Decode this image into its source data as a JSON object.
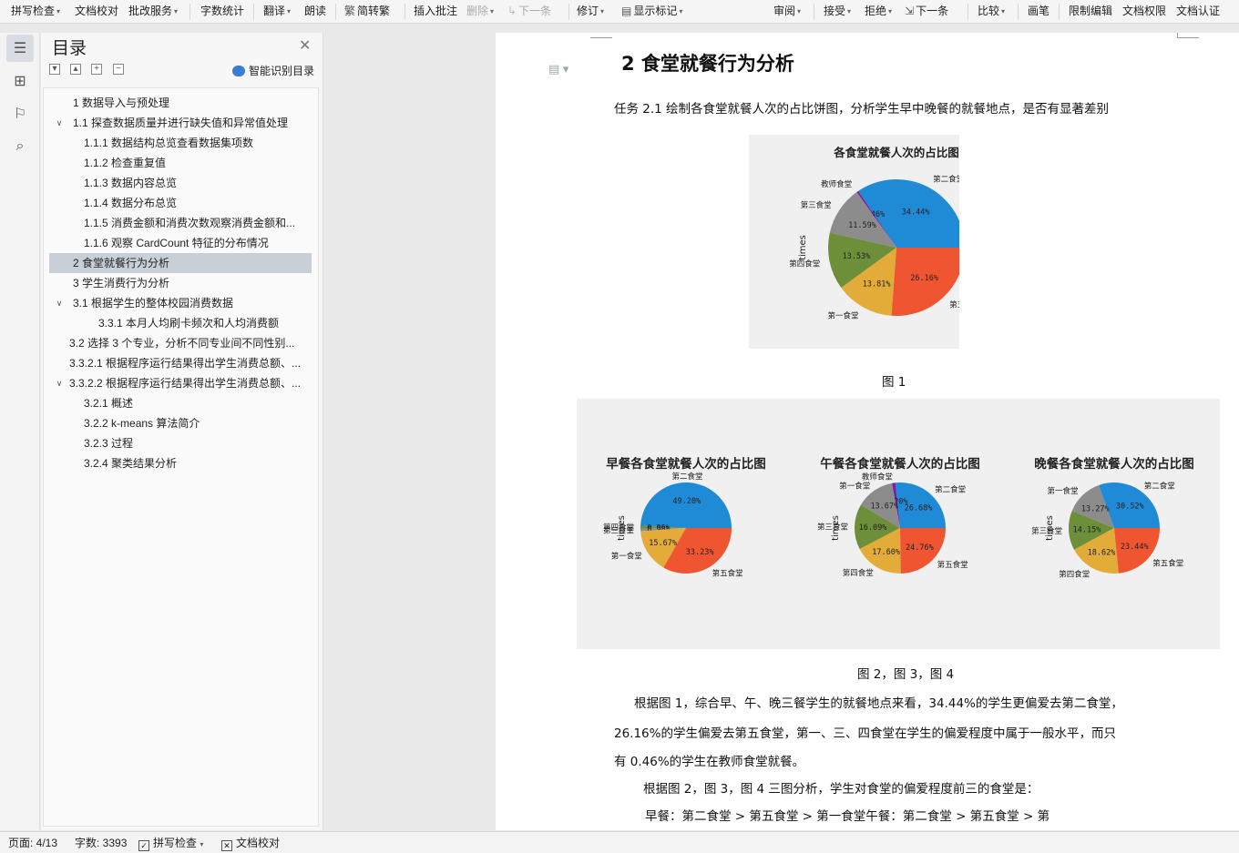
{
  "toolbar": {
    "items": [
      {
        "label": "拼写检查",
        "caret": true
      },
      {
        "label": "文档校对",
        "caret": false
      },
      {
        "label": "批改服务",
        "caret": true
      },
      {
        "label": "字数统计",
        "caret": false
      },
      {
        "label": "翻译",
        "caret": true
      },
      {
        "label": "朗读",
        "caret": false
      },
      {
        "label": "简转繁",
        "caret": false
      },
      {
        "label": "插入批注",
        "caret": false
      },
      {
        "label": "删除",
        "caret": true
      },
      {
        "label": "下一条",
        "caret": false
      },
      {
        "label": "修订",
        "caret": true
      },
      {
        "label": "显示标记",
        "caret": true
      },
      {
        "label": "审阅",
        "caret": true
      },
      {
        "label": "接受",
        "caret": true
      },
      {
        "label": "拒绝",
        "caret": true
      },
      {
        "label": "下一条",
        "caret": false
      },
      {
        "label": "比较",
        "caret": true
      },
      {
        "label": "画笔",
        "caret": false
      },
      {
        "label": "限制编辑",
        "caret": false
      },
      {
        "label": "文档权限",
        "caret": false
      },
      {
        "label": "文档认证",
        "caret": false
      }
    ]
  },
  "sidebar": {
    "title": "目录",
    "smart_toc_label": "智能识别目录",
    "toc": [
      {
        "text": "1 数据导入与预处理"
      },
      {
        "text": "1.1 探查数据质量并进行缺失值和异常值处理",
        "expanded": true
      },
      {
        "text": "1.1.1 数据结构总览查看数据集项数"
      },
      {
        "text": "1.1.2 检查重复值"
      },
      {
        "text": "1.1.3 数据内容总览"
      },
      {
        "text": "1.1.4 数据分布总览"
      },
      {
        "text": "1.1.5 消费金额和消费次数观察消费金额和..."
      },
      {
        "text": "1.1.6 观察 CardCount 特征的分布情况"
      },
      {
        "text": "2 食堂就餐行为分析",
        "selected": true
      },
      {
        "text": "3 学生消费行为分析"
      },
      {
        "text": "3.1 根据学生的整体校园消费数据",
        "expanded": true
      },
      {
        "text": "3.3.1 本月人均刷卡频次和人均消费额"
      },
      {
        "text": "3.2 选择 3 个专业，分析不同专业间不同性别..."
      },
      {
        "text": "3.3.2.1 根据程序运行结果得出学生消费总额、..."
      },
      {
        "text": "3.3.2.2 根据程序运行结果得出学生消费总额、...",
        "expanded": true
      },
      {
        "text": "3.2.1 概述"
      },
      {
        "text": "3.2.2 k-means 算法简介"
      },
      {
        "text": "3.2.3 过程"
      },
      {
        "text": "3.2.4 聚类结果分析"
      }
    ]
  },
  "document": {
    "heading": "2 食堂就餐行为分析",
    "task_text": "任务 2.1 绘制各食堂就餐人次的占比饼图，分析学生早中晚餐的就餐地点，是否有显著差别",
    "caption1": "图 1",
    "caption2": "图 2，图 3，图 4",
    "para1_line1": "根据图 1，综合早、午、晚三餐学生的就餐地点来看，34.44%的学生更偏爱去第二食堂，",
    "para1_line2": "26.16%的学生偏爱去第五食堂，第一、三、四食堂在学生的偏爱程度中属于一般水平，而只",
    "para1_line3": "有 0.46%的学生在教师食堂就餐。",
    "para2": "根据图 2，图 3，图 4 三图分析，学生对食堂的偏爱程度前三的食堂是：",
    "para3": "早餐：第二食堂 > 第五食堂 > 第一食堂午餐：第二食堂 > 第五食堂 > 第"
  },
  "chart_data": [
    {
      "type": "pie",
      "title": "各食堂就餐人次的占比图",
      "ylabel": "times",
      "slices": [
        {
          "label": "第二食堂",
          "value": 34.44,
          "value_label": "34.44%",
          "color": "#1f8ad6"
        },
        {
          "label": "教师食堂",
          "value": 0.46,
          "value_label": "0.46%",
          "color": "#7b1fa2"
        },
        {
          "label": "第三食堂",
          "value": 11.59,
          "value_label": "11.59%",
          "color": "#8c8c8c"
        },
        {
          "label": "第四食堂",
          "value": 13.53,
          "value_label": "13.53%",
          "color": "#6e8f3a"
        },
        {
          "label": "第一食堂",
          "value": 13.81,
          "value_label": "13.81%",
          "color": "#e3ac39"
        },
        {
          "label": "第五食堂",
          "value": 26.16,
          "value_label": "26.16%",
          "color": "#ef5530"
        }
      ]
    },
    {
      "type": "pie",
      "title": "早餐各食堂就餐人次的占比图",
      "ylabel": "times",
      "slices": [
        {
          "label": "第二食堂",
          "value": 49.2,
          "value_label": "49.20%",
          "color": "#1f8ad6"
        },
        {
          "label": "第四食堂",
          "value": 0.96,
          "value_label": "0.96%",
          "color": "#6e8f3a"
        },
        {
          "label": "第三食堂",
          "value": 0.98,
          "value_label": "0.98%",
          "color": "#8c8c8c"
        },
        {
          "label": "第一食堂",
          "value": 15.67,
          "value_label": "15.67%",
          "color": "#e3ac39"
        },
        {
          "label": "第五食堂",
          "value": 33.23,
          "value_label": "33.23%",
          "color": "#ef5530"
        }
      ]
    },
    {
      "type": "pie",
      "title": "午餐各食堂就餐人次的占比图",
      "ylabel": "times",
      "slices": [
        {
          "label": "第二食堂",
          "value": 26.68,
          "value_label": "26.68%",
          "color": "#1f8ad6"
        },
        {
          "label": "教师食堂",
          "value": 1.2,
          "value_label": "1.20%",
          "color": "#7b1fa2"
        },
        {
          "label": "第一食堂",
          "value": 13.67,
          "value_label": "13.67%",
          "color": "#8c8c8c"
        },
        {
          "label": "第三食堂",
          "value": 16.09,
          "value_label": "16.09%",
          "color": "#6e8f3a"
        },
        {
          "label": "第四食堂",
          "value": 17.6,
          "value_label": "17.60%",
          "color": "#e3ac39"
        },
        {
          "label": "第五食堂",
          "value": 24.76,
          "value_label": "24.76%",
          "color": "#ef5530"
        }
      ]
    },
    {
      "type": "pie",
      "title": "晚餐各食堂就餐人次的占比图",
      "ylabel": "times",
      "slices": [
        {
          "label": "第二食堂",
          "value": 30.52,
          "value_label": "30.52%",
          "color": "#1f8ad6"
        },
        {
          "label": "第一食堂",
          "value": 13.27,
          "value_label": "13.27%",
          "color": "#8c8c8c"
        },
        {
          "label": "第三食堂",
          "value": 14.15,
          "value_label": "14.15%",
          "color": "#6e8f3a"
        },
        {
          "label": "第四食堂",
          "value": 18.62,
          "value_label": "18.62%",
          "color": "#e3ac39"
        },
        {
          "label": "第五食堂",
          "value": 23.44,
          "value_label": "23.44%",
          "color": "#ef5530"
        }
      ]
    }
  ],
  "statusbar": {
    "page": "页面: 4/13",
    "words": "字数: 3393",
    "spell": "拼写检查",
    "proof": "文档校对"
  }
}
